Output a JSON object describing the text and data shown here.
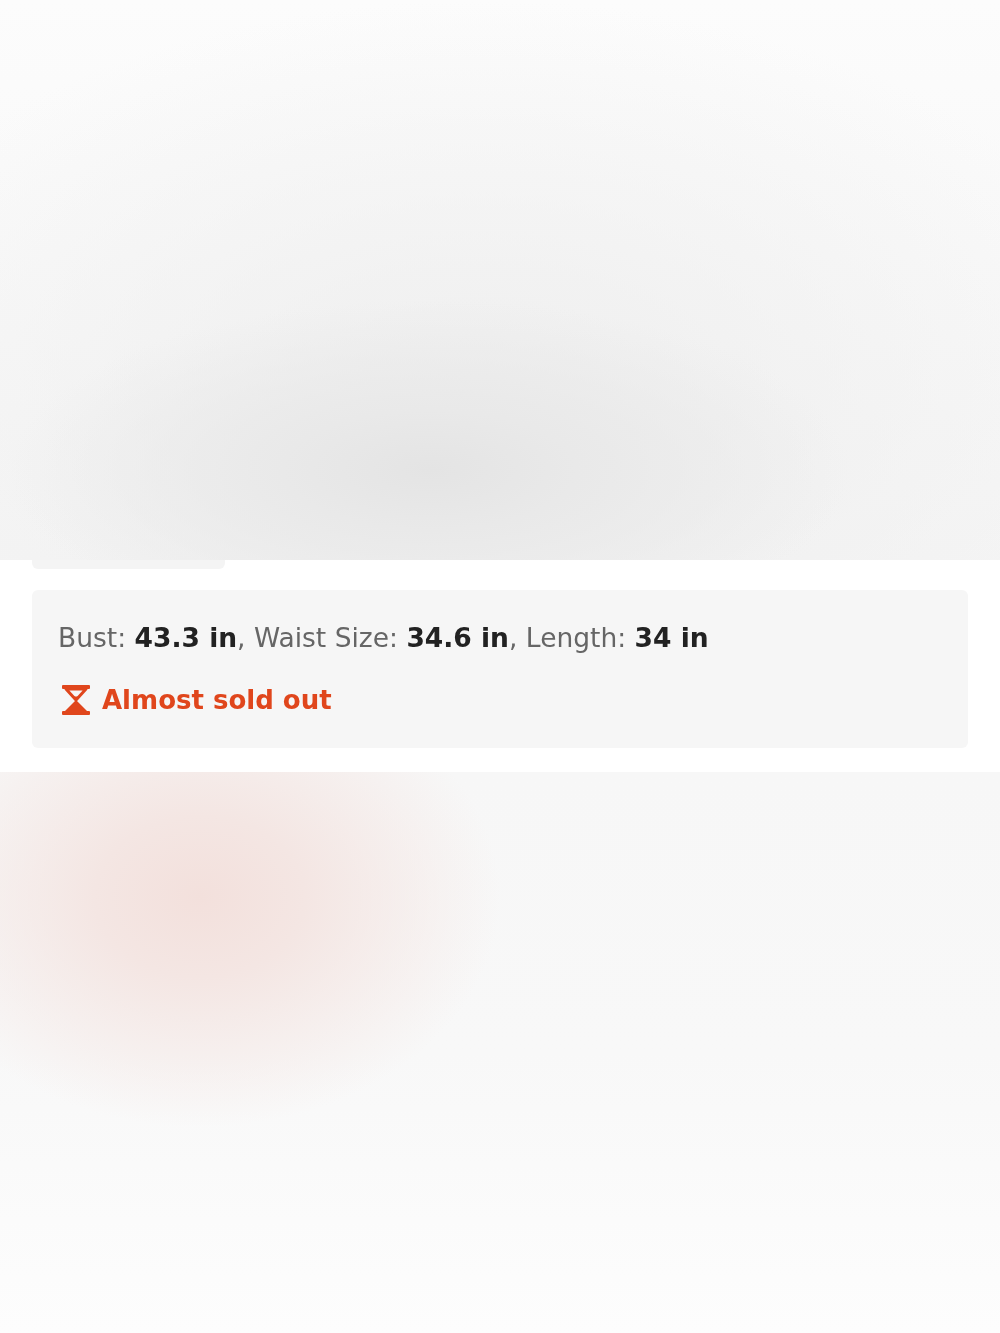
{
  "size_card": {
    "measurements": "Bust: **43.3 in**, Waist Size: **34.6 in**, Length: **34 in**",
    "stock_alert": {
      "text": "Almost sold out"
    }
  }
}
